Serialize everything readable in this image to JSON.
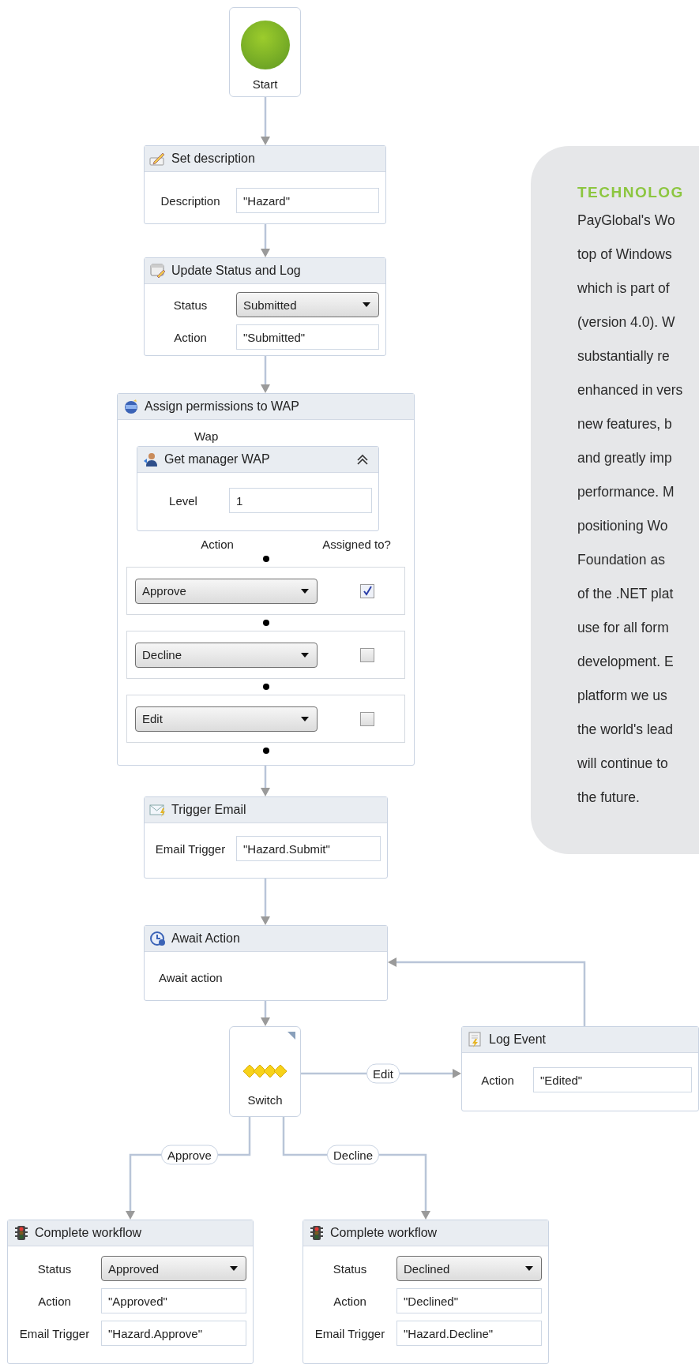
{
  "workflow": {
    "nodes": [
      {
        "kind": "start",
        "label": "Start"
      },
      {
        "kind": "form",
        "title": "Set description",
        "fields": [
          {
            "kind": "text",
            "label": "Description",
            "value": "\"Hazard\""
          }
        ]
      },
      {
        "kind": "form",
        "title": "Update Status and Log",
        "fields": [
          {
            "kind": "dropdown",
            "label": "Status",
            "value": "Submitted"
          },
          {
            "kind": "text",
            "label": "Action",
            "value": "\"Submitted\""
          }
        ]
      },
      {
        "kind": "scope",
        "title": "Assign permissions to WAP",
        "variable_label": "Wap",
        "child": {
          "title": "Get manager WAP",
          "fields": [
            {
              "kind": "text",
              "label": "Level",
              "value": "1"
            }
          ]
        },
        "columns": [
          "Action",
          "Assigned to?"
        ],
        "rows": [
          {
            "action": "Approve",
            "checked": true
          },
          {
            "action": "Decline",
            "checked": false
          },
          {
            "action": "Edit",
            "checked": false
          }
        ]
      },
      {
        "kind": "form",
        "title": "Trigger Email",
        "fields": [
          {
            "kind": "text",
            "label": "Email Trigger",
            "value": "\"Hazard.Submit\""
          }
        ]
      },
      {
        "kind": "note",
        "title": "Await Action",
        "text": "Await action"
      },
      {
        "kind": "switch",
        "label": "Switch"
      },
      {
        "kind": "form",
        "title": "Log Event",
        "fields": [
          {
            "kind": "text",
            "label": "Action",
            "value": "\"Edited\""
          }
        ]
      },
      {
        "kind": "form",
        "title": "Complete workflow",
        "fields": [
          {
            "kind": "dropdown",
            "label": "Status",
            "value": "Approved"
          },
          {
            "kind": "text",
            "label": "Action",
            "value": "\"Approved\""
          },
          {
            "kind": "text",
            "label": "Email Trigger",
            "value": "\"Hazard.Approve\""
          }
        ]
      },
      {
        "kind": "form",
        "title": "Complete workflow",
        "fields": [
          {
            "kind": "dropdown",
            "label": "Status",
            "value": "Declined"
          },
          {
            "kind": "text",
            "label": "Action",
            "value": "\"Declined\""
          },
          {
            "kind": "text",
            "label": "Email Trigger",
            "value": "\"Hazard.Decline\""
          }
        ]
      }
    ],
    "cases": [
      {
        "label": "Edit"
      },
      {
        "label": "Approve"
      },
      {
        "label": "Decline"
      }
    ]
  },
  "info_panel": {
    "heading": "TECHNOLOG",
    "lines": [
      "PayGlobal's Wo",
      "top of Windows",
      "which is part of",
      "(version 4.0). W",
      "substantially re",
      "enhanced in vers",
      "new features, b",
      "and greatly imp",
      "performance. M",
      "positioning Wo",
      "Foundation as",
      "of the .NET plat",
      "use for all form",
      "development. E",
      "platform we us",
      "the world's lead",
      "will continue to",
      "the future."
    ]
  }
}
